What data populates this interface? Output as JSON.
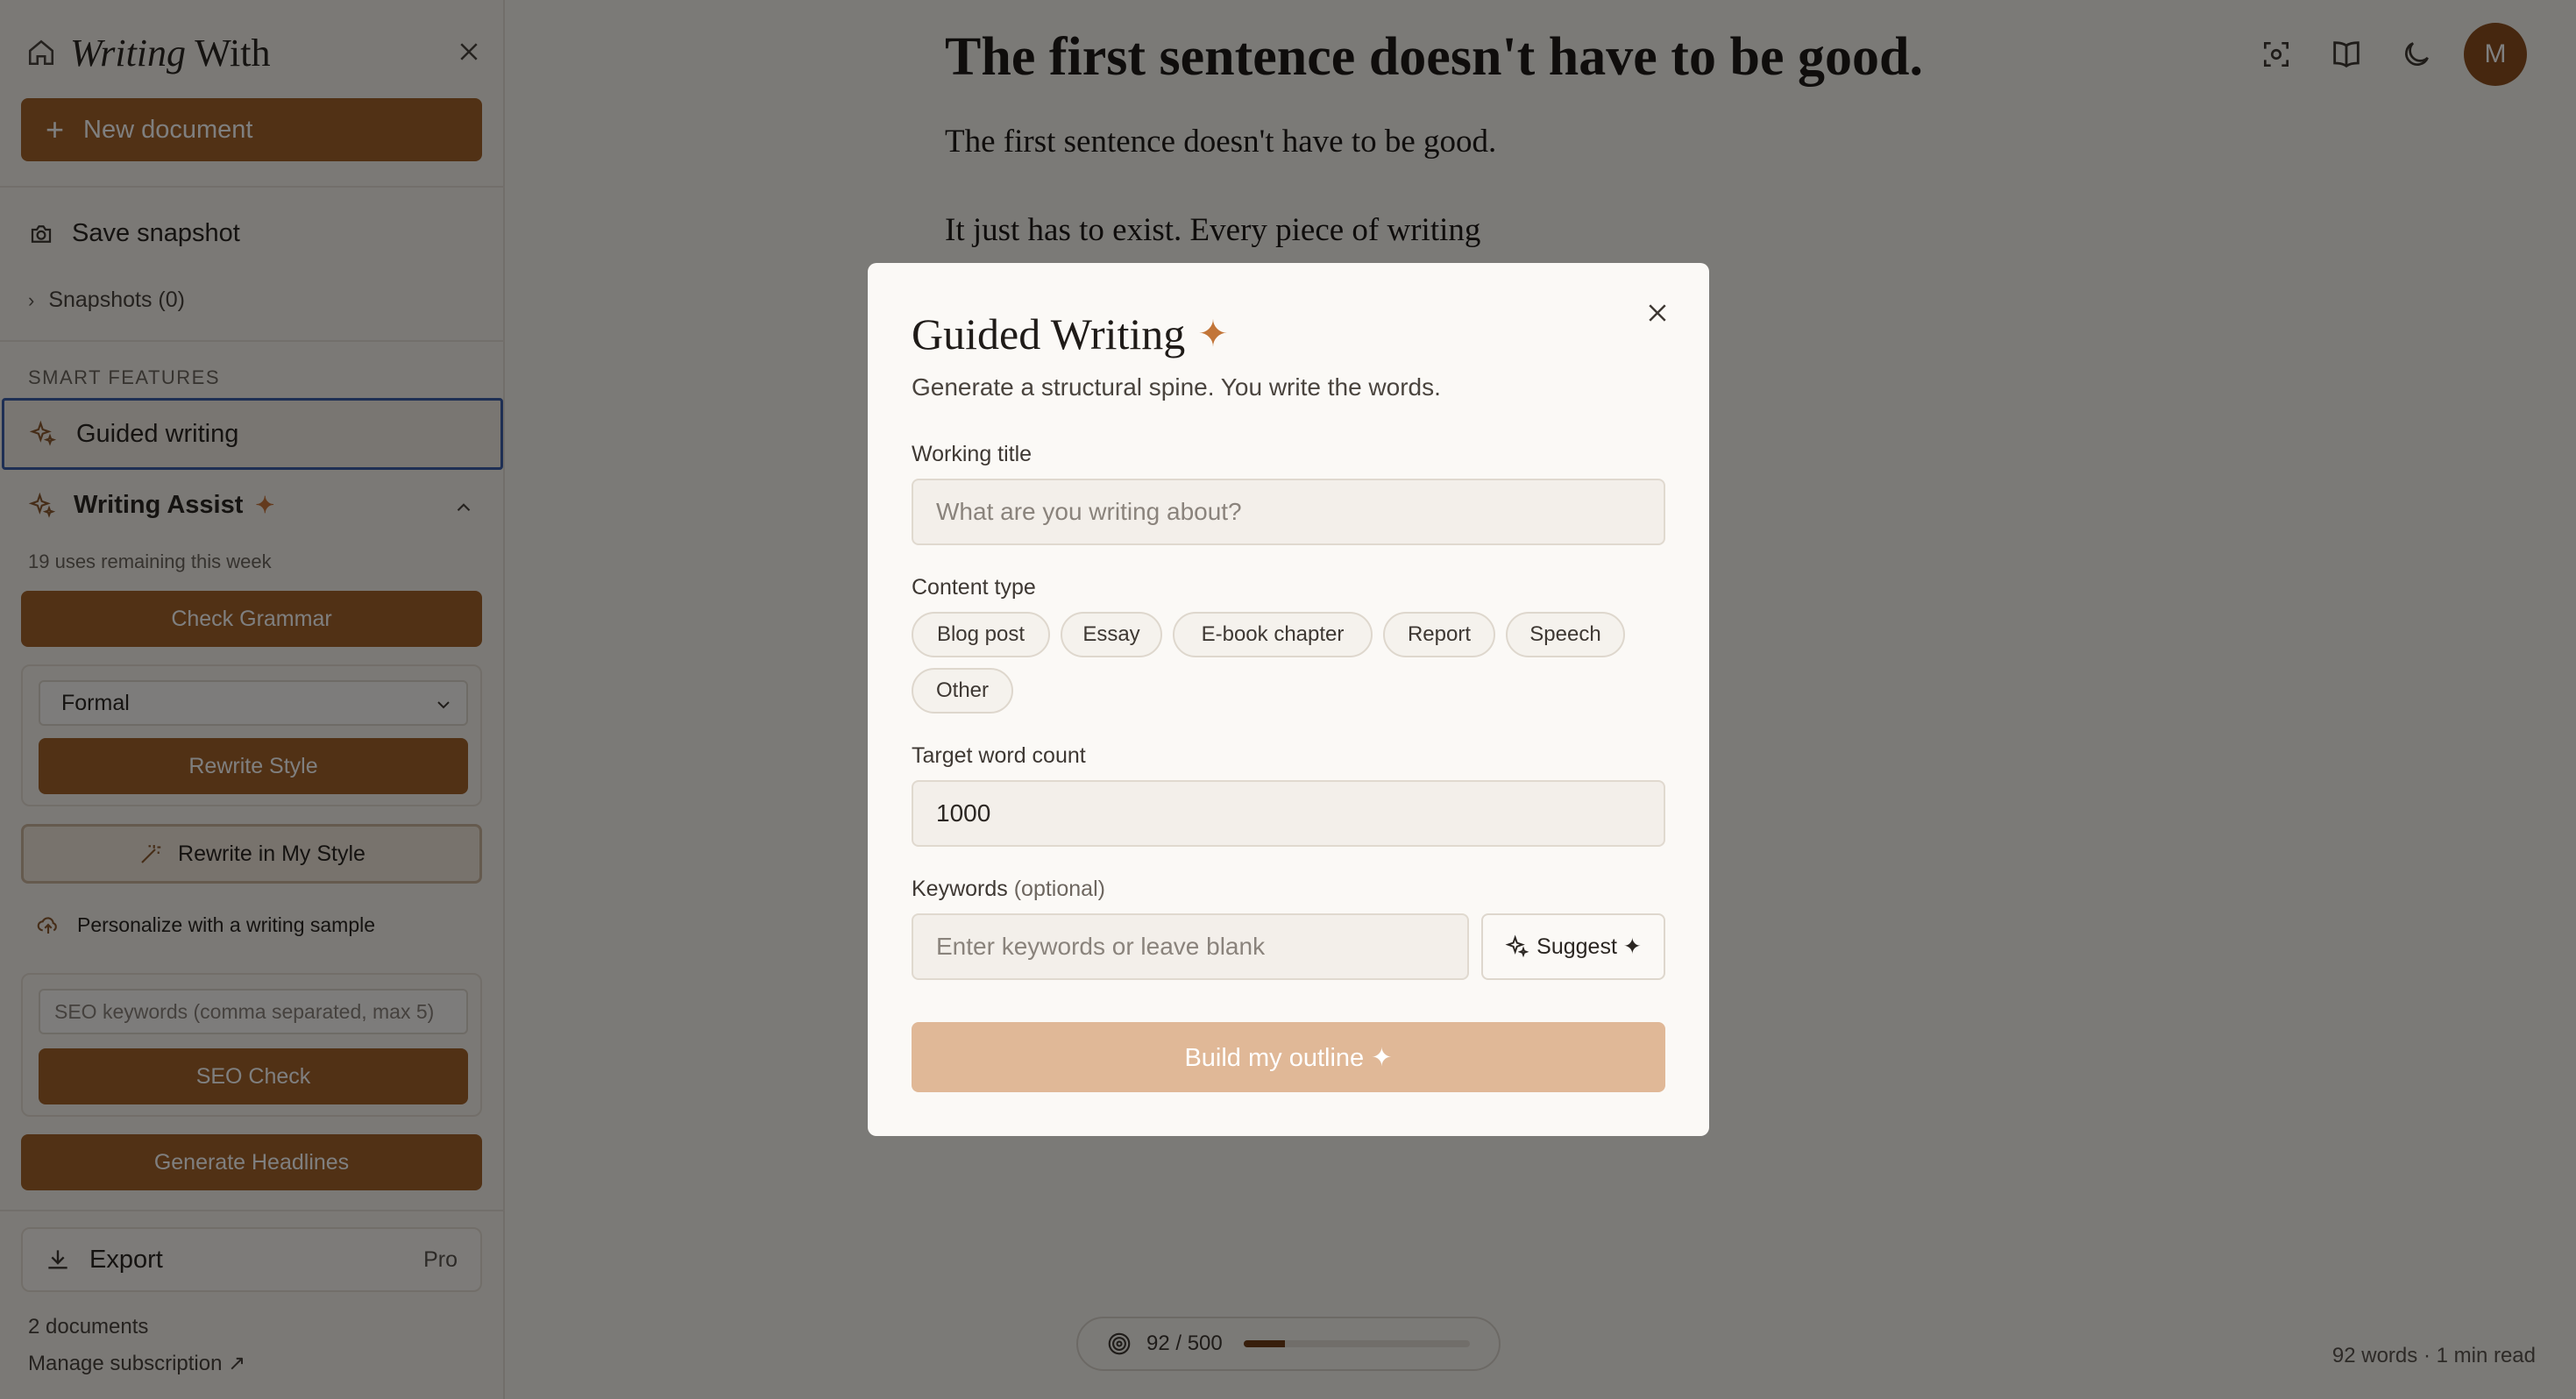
{
  "sidebar": {
    "brand_italic": "Writing",
    "brand_rest": " With",
    "new_document": "New document",
    "save_snapshot": "Save snapshot",
    "snapshots": "Snapshots (0)",
    "smart_features_label": "SMART FEATURES",
    "guided_writing": "Guided writing",
    "writing_assist": "Writing Assist",
    "writing_assist_star": "✦",
    "uses_remaining": "19 uses remaining this week",
    "check_grammar": "Check Grammar",
    "style_select_value": "Formal",
    "rewrite_style": "Rewrite Style",
    "rewrite_my_style": "Rewrite in My Style",
    "personalize": "Personalize with a writing sample",
    "seo_placeholder": "SEO keywords (comma separated, max 5)",
    "seo_check": "SEO Check",
    "generate_headlines": "Generate Headlines",
    "export": "Export",
    "export_badge": "Pro",
    "documents_count": "2 documents",
    "manage_subscription": "Manage subscription ↗"
  },
  "editor": {
    "title": "The first sentence doesn't have to be good.",
    "paragraph_1": "The first sentence doesn't have to be good.",
    "paragraph_2": "It just has to exist. Every piece of writing",
    "avatar_initial": "M",
    "progress_text": "92 / 500",
    "progress_fraction": 0.184,
    "word_count": "92 words · 1 min read"
  },
  "modal": {
    "title": "Guided Writing",
    "title_star": "✦",
    "subtitle": "Generate a structural spine. You write the words.",
    "working_title_label": "Working title",
    "working_title_placeholder": "What are you writing about?",
    "content_type_label": "Content type",
    "content_types": [
      "Blog post",
      "Essay",
      "E-book chapter",
      "Report",
      "Speech",
      "Other"
    ],
    "target_word_count_label": "Target word count",
    "target_word_count_value": "1000",
    "keywords_label": "Keywords",
    "keywords_optional": "(optional)",
    "keywords_placeholder": "Enter keywords or leave blank",
    "suggest_button": "Suggest ✦",
    "build_button": "Build my outline ✦"
  },
  "colors": {
    "accent": "#a3622a",
    "accent_disabled": "#e0b897",
    "focus_ring": "#3c5fa8",
    "avatar": "#8c4e1f"
  },
  "icons": [
    "home-icon",
    "close-icon",
    "plus-icon",
    "camera-icon",
    "chevron-right-icon",
    "sparkles-icon",
    "chevron-up-icon",
    "chevron-down-icon",
    "magic-wand-icon",
    "cloud-upload-icon",
    "download-icon",
    "focus-icon",
    "book-icon",
    "moon-icon",
    "target-icon"
  ]
}
